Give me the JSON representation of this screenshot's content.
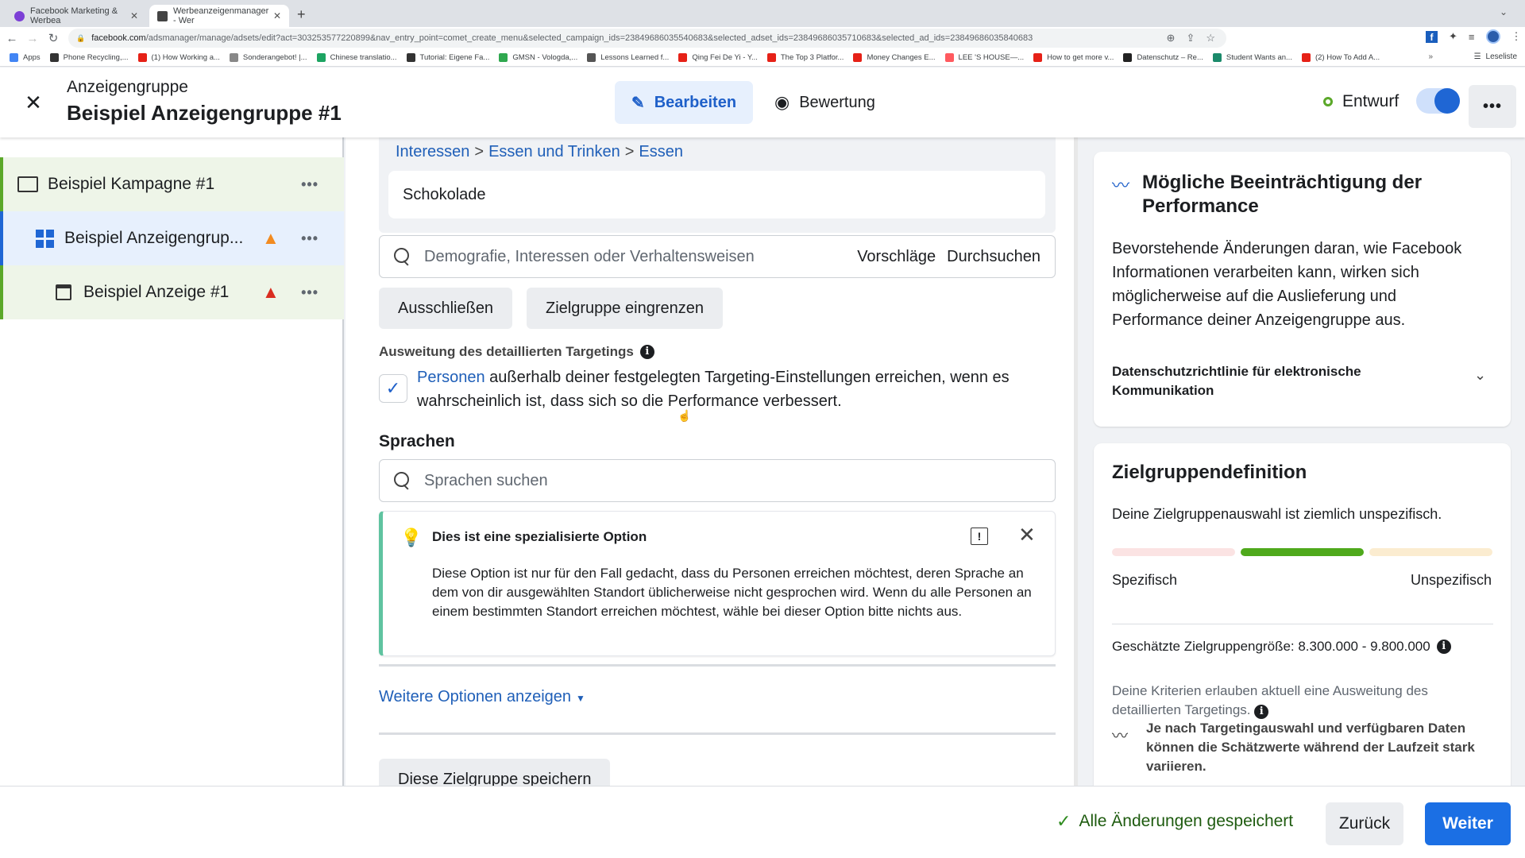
{
  "browser": {
    "tabs": [
      {
        "title": "Facebook Marketing & Werbea",
        "favicon_color": "#7c3fd6",
        "active": false
      },
      {
        "title": "Werbeanzeigenmanager - Wer",
        "favicon_color": "#444444",
        "active": true
      }
    ],
    "url_domain": "facebook.com",
    "url_path": "/adsmanager/manage/adsets/edit?act=303253577220899&nav_entry_point=comet_create_menu&selected_campaign_ids=23849686035540683&selected_adset_ids=23849686035710683&selected_ad_ids=23849686035840683",
    "bookmarks": [
      {
        "label": "Apps",
        "color": "#4285f4"
      },
      {
        "label": "Phone Recycling,...",
        "color": "#333333"
      },
      {
        "label": "(1) How Working a...",
        "color": "#e62117"
      },
      {
        "label": "Sonderangebot! |...",
        "color": "#888888"
      },
      {
        "label": "Chinese translatio...",
        "color": "#1da462"
      },
      {
        "label": "Tutorial: Eigene Fa...",
        "color": "#333333"
      },
      {
        "label": "GMSN - Vologda,...",
        "color": "#2fa84f"
      },
      {
        "label": "Lessons Learned f...",
        "color": "#555555"
      },
      {
        "label": "Qing Fei De Yi - Y...",
        "color": "#e62117"
      },
      {
        "label": "The Top 3 Platfor...",
        "color": "#e62117"
      },
      {
        "label": "Money Changes E...",
        "color": "#e62117"
      },
      {
        "label": "LEE 'S HOUSE—...",
        "color": "#ff5a5f"
      },
      {
        "label": "How to get more v...",
        "color": "#e62117"
      },
      {
        "label": "Datenschutz – Re...",
        "color": "#222222"
      },
      {
        "label": "Student Wants an...",
        "color": "#1b8a6b"
      },
      {
        "label": "(2) How To Add A...",
        "color": "#e62117"
      }
    ],
    "reading_list": "Leseliste"
  },
  "header": {
    "subtitle": "Anzeigengruppe",
    "title": "Beispiel Anzeigengruppe #1",
    "edit_label": "Bearbeiten",
    "review_label": "Bewertung",
    "status_label": "Entwurf",
    "toggle_on": true
  },
  "sidebar": {
    "items": [
      {
        "label": "Beispiel Kampagne #1",
        "icon": "folder-icon",
        "warning": null
      },
      {
        "label": "Beispiel Anzeigengrup...",
        "icon": "adset-grid-icon",
        "warning": "orange"
      },
      {
        "label": "Beispiel Anzeige #1",
        "icon": "ad-icon",
        "warning": "red"
      }
    ]
  },
  "main": {
    "breadcrumb": [
      "Interessen",
      "Essen und Trinken",
      "Essen"
    ],
    "selected_interest": "Schokolade",
    "target_search": {
      "placeholder": "Demografie, Interessen oder Verhaltensweisen",
      "suggestions": "Vorschläge",
      "browse": "Durchsuchen"
    },
    "exclude_label": "Ausschließen",
    "narrow_label": "Zielgruppe eingrenzen",
    "expansion": {
      "label": "Ausweitung des detaillierten Targetings",
      "checked": true,
      "link_text": "Personen",
      "text": " außerhalb deiner festgelegten Targeting-Einstellungen erreichen, wenn es wahrscheinlich ist, dass sich so die Performance verbessert."
    },
    "languages": {
      "title": "Sprachen",
      "placeholder": "Sprachen suchen"
    },
    "notice": {
      "title": "Dies ist eine spezialisierte Option",
      "body": "Diese Option ist nur für den Fall gedacht, dass du Personen erreichen möchtest, deren Sprache an dem von dir ausgewählten Standort üblicherweise nicht gesprochen wird. Wenn du alle Personen an einem bestimmten Standort erreichen möchtest, wähle bei dieser Option bitte nichts aus."
    },
    "more_options": "Weitere Optionen anzeigen",
    "save_audience": "Diese Zielgruppe speichern"
  },
  "right": {
    "perf_card": {
      "title": "Mögliche Beeinträchtigung der Performance",
      "body": "Bevorstehende Änderungen daran, wie Facebook Informationen verarbeiten kann, wirken sich möglicherweise auf die Auslieferung und Performance deiner Anzeigengruppe aus.",
      "policy": "Datenschutzrichtlinie für elektronische Kommunikation"
    },
    "audience_card": {
      "title": "Zielgruppendefinition",
      "summary": "Deine Zielgruppenauswahl ist ziemlich unspezifisch.",
      "meter_segments": [
        {
          "name": "specific",
          "color": "#fbe3e3",
          "active": false
        },
        {
          "name": "balanced",
          "color": "#4fa91c",
          "active": true
        },
        {
          "name": "broad",
          "color": "#fbecd0",
          "active": false
        }
      ],
      "label_left": "Spezifisch",
      "label_right": "Unspezifisch",
      "size_label": "Geschätzte Zielgruppengröße: 8.300.000 - 9.800.000",
      "criteria": "Deine Kriterien erlauben aktuell eine Ausweitung des detaillierten Targetings.",
      "variance": "Je nach Targetingauswahl und verfügbaren Daten können die Schätzwerte während der Laufzeit stark variieren."
    }
  },
  "footer": {
    "saved_label": "Alle Änderungen gespeichert",
    "back_label": "Zurück",
    "next_label": "Weiter"
  }
}
